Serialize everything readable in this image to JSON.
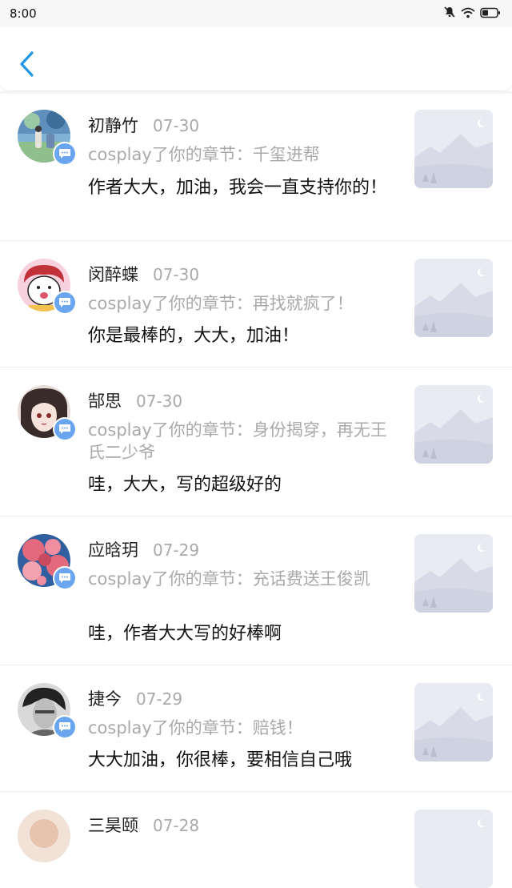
{
  "status_bar": {
    "time": "8:00",
    "icons": [
      "mute-icon",
      "wifi-icon",
      "battery-icon"
    ]
  },
  "header": {
    "back_icon": "chevron-left-icon",
    "accent_color": "#1f96e8"
  },
  "items": [
    {
      "name": "初静竹",
      "date": "07-30",
      "chapter": "cosplay了你的章节：千玺进帮",
      "comment": "作者大大，加油，我会一直支持你的！"
    },
    {
      "name": "闵醉蝶",
      "date": "07-30",
      "chapter": "cosplay了你的章节：再找就疯了！",
      "comment": "你是最棒的，大大，加油！"
    },
    {
      "name": "郜思",
      "date": "07-30",
      "chapter": "cosplay了你的章节：身份揭穿，再无王氏二少爷",
      "comment": "哇，大大，写的超级好的"
    },
    {
      "name": "应晗玥",
      "date": "07-29",
      "chapter": "cosplay了你的章节：充话费送王俊凯",
      "comment": "哇，作者大大写的好棒啊"
    },
    {
      "name": "捷今",
      "date": "07-29",
      "chapter": "cosplay了你的章节：赔钱！",
      "comment": "大大加油，你很棒，要相信自己哦"
    },
    {
      "name": "三昊颐",
      "date": "07-28",
      "chapter": "",
      "comment": ""
    }
  ]
}
